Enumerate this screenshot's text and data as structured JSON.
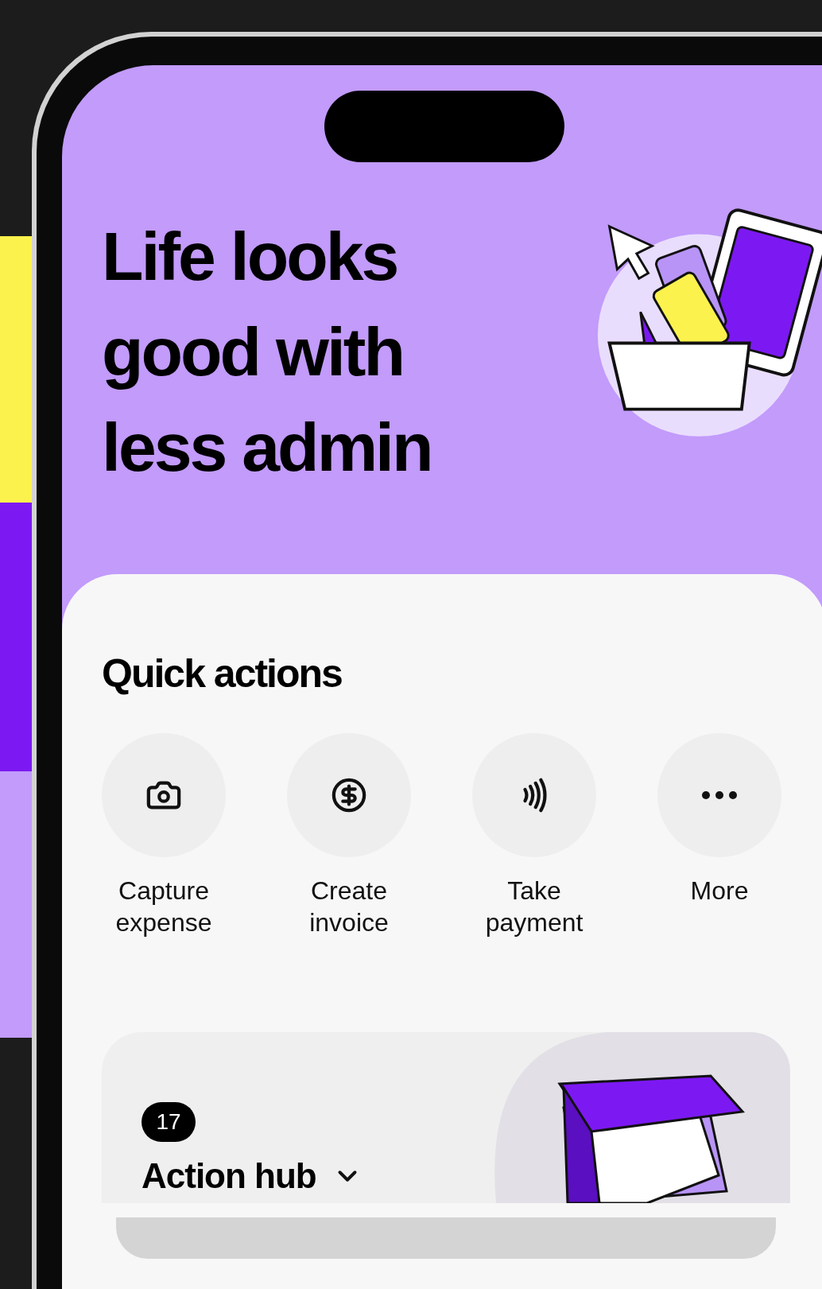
{
  "headline": "Life looks good with less admin",
  "quick_actions": {
    "title": "Quick actions",
    "items": [
      {
        "label": "Capture expense"
      },
      {
        "label": "Create invoice"
      },
      {
        "label": "Take payment"
      },
      {
        "label": "More"
      }
    ]
  },
  "action_hub": {
    "count": "17",
    "title": "Action hub"
  }
}
